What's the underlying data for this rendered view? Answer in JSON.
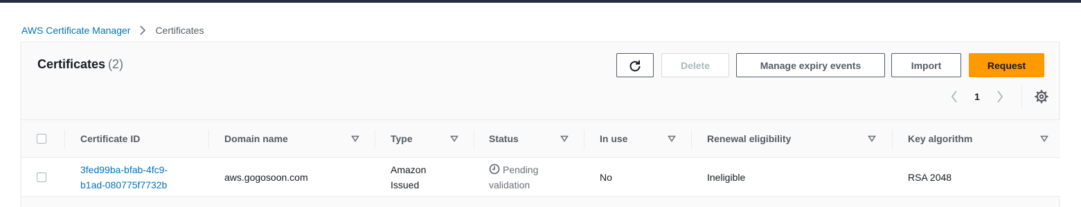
{
  "breadcrumb": {
    "root": "AWS Certificate Manager",
    "current": "Certificates"
  },
  "header": {
    "title": "Certificates",
    "count": "(2)"
  },
  "actions": {
    "delete": "Delete",
    "manage_expiry": "Manage expiry events",
    "import": "Import",
    "request": "Request"
  },
  "pagination": {
    "page": "1"
  },
  "columns": {
    "certificate_id": "Certificate ID",
    "domain_name": "Domain name",
    "type": "Type",
    "status": "Status",
    "in_use": "In use",
    "renewal_eligibility": "Renewal eligibility",
    "key_algorithm": "Key algorithm"
  },
  "rows": [
    {
      "certificate_id_line1": "3fed99ba-bfab-4fc9-",
      "certificate_id_line2": "b1ad-080775f7732b",
      "domain_name": "aws.gogosoon.com",
      "type_line1": "Amazon",
      "type_line2": "Issued",
      "status_line1": "Pending",
      "status_line2": "validation",
      "in_use": "No",
      "renewal_eligibility": "Ineligible",
      "key_algorithm": "RSA 2048"
    }
  ],
  "colors": {
    "accent_orange": "#ff9900",
    "link_blue": "#0073bb",
    "top_bar": "#232f3e"
  },
  "icons": {
    "refresh": "refresh-icon",
    "prev": "chevron-left-icon",
    "next": "chevron-right-icon",
    "settings": "gear-icon",
    "sort": "caret-down-icon",
    "pending": "clock-icon"
  }
}
